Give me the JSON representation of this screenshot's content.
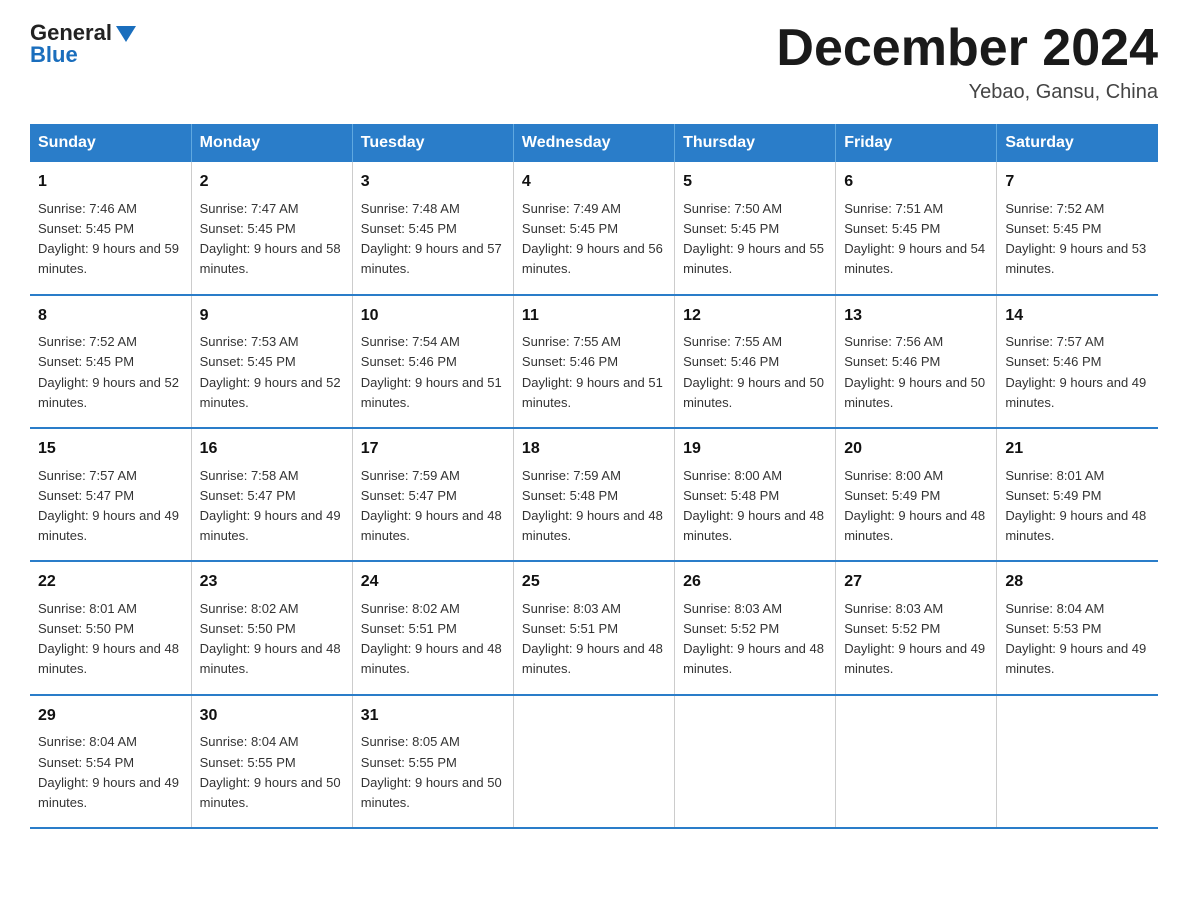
{
  "header": {
    "logo_general": "General",
    "logo_blue": "Blue",
    "month_title": "December 2024",
    "location": "Yebao, Gansu, China"
  },
  "weekdays": [
    "Sunday",
    "Monday",
    "Tuesday",
    "Wednesday",
    "Thursday",
    "Friday",
    "Saturday"
  ],
  "weeks": [
    [
      {
        "day": "1",
        "sunrise": "7:46 AM",
        "sunset": "5:45 PM",
        "daylight": "9 hours and 59 minutes."
      },
      {
        "day": "2",
        "sunrise": "7:47 AM",
        "sunset": "5:45 PM",
        "daylight": "9 hours and 58 minutes."
      },
      {
        "day": "3",
        "sunrise": "7:48 AM",
        "sunset": "5:45 PM",
        "daylight": "9 hours and 57 minutes."
      },
      {
        "day": "4",
        "sunrise": "7:49 AM",
        "sunset": "5:45 PM",
        "daylight": "9 hours and 56 minutes."
      },
      {
        "day": "5",
        "sunrise": "7:50 AM",
        "sunset": "5:45 PM",
        "daylight": "9 hours and 55 minutes."
      },
      {
        "day": "6",
        "sunrise": "7:51 AM",
        "sunset": "5:45 PM",
        "daylight": "9 hours and 54 minutes."
      },
      {
        "day": "7",
        "sunrise": "7:52 AM",
        "sunset": "5:45 PM",
        "daylight": "9 hours and 53 minutes."
      }
    ],
    [
      {
        "day": "8",
        "sunrise": "7:52 AM",
        "sunset": "5:45 PM",
        "daylight": "9 hours and 52 minutes."
      },
      {
        "day": "9",
        "sunrise": "7:53 AM",
        "sunset": "5:45 PM",
        "daylight": "9 hours and 52 minutes."
      },
      {
        "day": "10",
        "sunrise": "7:54 AM",
        "sunset": "5:46 PM",
        "daylight": "9 hours and 51 minutes."
      },
      {
        "day": "11",
        "sunrise": "7:55 AM",
        "sunset": "5:46 PM",
        "daylight": "9 hours and 51 minutes."
      },
      {
        "day": "12",
        "sunrise": "7:55 AM",
        "sunset": "5:46 PM",
        "daylight": "9 hours and 50 minutes."
      },
      {
        "day": "13",
        "sunrise": "7:56 AM",
        "sunset": "5:46 PM",
        "daylight": "9 hours and 50 minutes."
      },
      {
        "day": "14",
        "sunrise": "7:57 AM",
        "sunset": "5:46 PM",
        "daylight": "9 hours and 49 minutes."
      }
    ],
    [
      {
        "day": "15",
        "sunrise": "7:57 AM",
        "sunset": "5:47 PM",
        "daylight": "9 hours and 49 minutes."
      },
      {
        "day": "16",
        "sunrise": "7:58 AM",
        "sunset": "5:47 PM",
        "daylight": "9 hours and 49 minutes."
      },
      {
        "day": "17",
        "sunrise": "7:59 AM",
        "sunset": "5:47 PM",
        "daylight": "9 hours and 48 minutes."
      },
      {
        "day": "18",
        "sunrise": "7:59 AM",
        "sunset": "5:48 PM",
        "daylight": "9 hours and 48 minutes."
      },
      {
        "day": "19",
        "sunrise": "8:00 AM",
        "sunset": "5:48 PM",
        "daylight": "9 hours and 48 minutes."
      },
      {
        "day": "20",
        "sunrise": "8:00 AM",
        "sunset": "5:49 PM",
        "daylight": "9 hours and 48 minutes."
      },
      {
        "day": "21",
        "sunrise": "8:01 AM",
        "sunset": "5:49 PM",
        "daylight": "9 hours and 48 minutes."
      }
    ],
    [
      {
        "day": "22",
        "sunrise": "8:01 AM",
        "sunset": "5:50 PM",
        "daylight": "9 hours and 48 minutes."
      },
      {
        "day": "23",
        "sunrise": "8:02 AM",
        "sunset": "5:50 PM",
        "daylight": "9 hours and 48 minutes."
      },
      {
        "day": "24",
        "sunrise": "8:02 AM",
        "sunset": "5:51 PM",
        "daylight": "9 hours and 48 minutes."
      },
      {
        "day": "25",
        "sunrise": "8:03 AM",
        "sunset": "5:51 PM",
        "daylight": "9 hours and 48 minutes."
      },
      {
        "day": "26",
        "sunrise": "8:03 AM",
        "sunset": "5:52 PM",
        "daylight": "9 hours and 48 minutes."
      },
      {
        "day": "27",
        "sunrise": "8:03 AM",
        "sunset": "5:52 PM",
        "daylight": "9 hours and 49 minutes."
      },
      {
        "day": "28",
        "sunrise": "8:04 AM",
        "sunset": "5:53 PM",
        "daylight": "9 hours and 49 minutes."
      }
    ],
    [
      {
        "day": "29",
        "sunrise": "8:04 AM",
        "sunset": "5:54 PM",
        "daylight": "9 hours and 49 minutes."
      },
      {
        "day": "30",
        "sunrise": "8:04 AM",
        "sunset": "5:55 PM",
        "daylight": "9 hours and 50 minutes."
      },
      {
        "day": "31",
        "sunrise": "8:05 AM",
        "sunset": "5:55 PM",
        "daylight": "9 hours and 50 minutes."
      },
      {
        "day": "",
        "sunrise": "",
        "sunset": "",
        "daylight": ""
      },
      {
        "day": "",
        "sunrise": "",
        "sunset": "",
        "daylight": ""
      },
      {
        "day": "",
        "sunrise": "",
        "sunset": "",
        "daylight": ""
      },
      {
        "day": "",
        "sunrise": "",
        "sunset": "",
        "daylight": ""
      }
    ]
  ]
}
